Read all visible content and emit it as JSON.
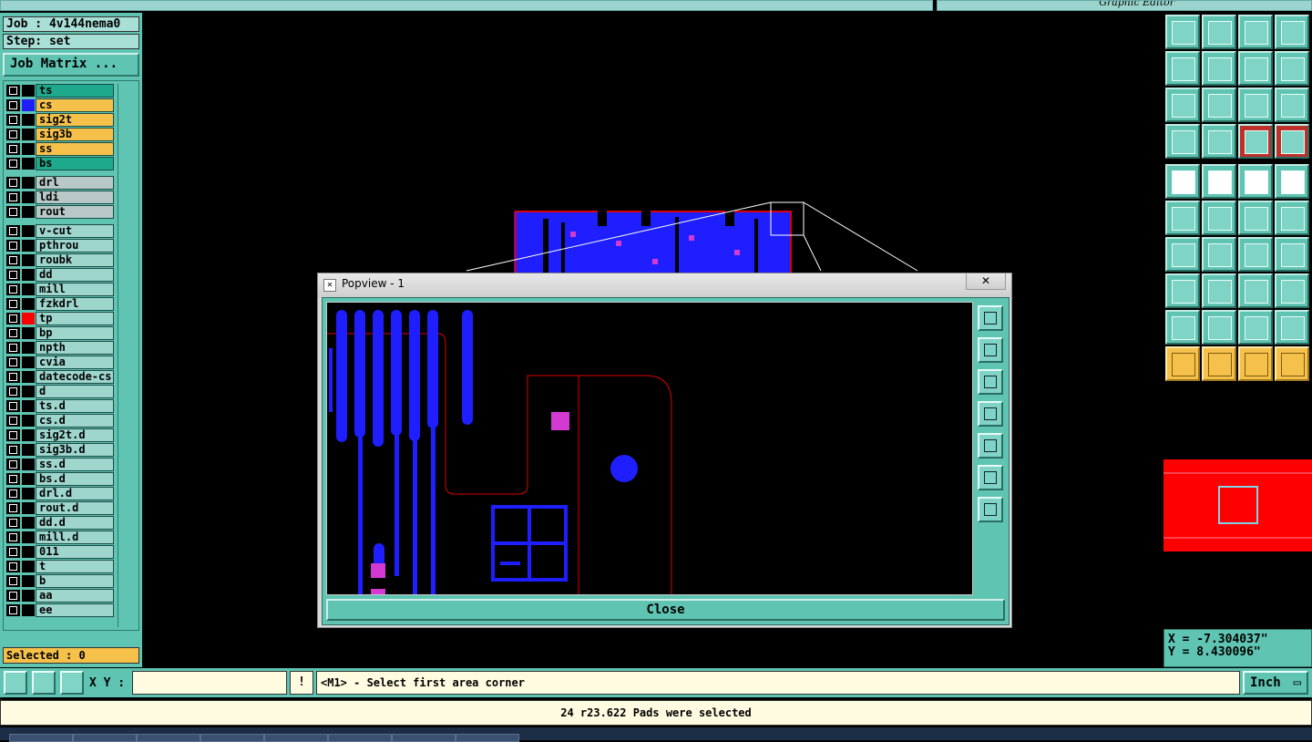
{
  "top_bar": {
    "right_title": "Graphic Editor"
  },
  "left_panel": {
    "job": "Job : 4v144nema0",
    "step": "Step: set",
    "job_matrix_label": "Job Matrix ...",
    "selected": "Selected : 0",
    "layers": [
      {
        "name": "ts",
        "kind": "board",
        "color": "#000000"
      },
      {
        "name": "cs",
        "kind": "sig",
        "color": "#1e1eff"
      },
      {
        "name": "sig2t",
        "kind": "sig",
        "color": "#000000"
      },
      {
        "name": "sig3b",
        "kind": "sig",
        "color": "#000000"
      },
      {
        "name": "ss",
        "kind": "sig",
        "color": "#000000"
      },
      {
        "name": "bs",
        "kind": "board",
        "color": "#000000"
      },
      {
        "name": "drl",
        "kind": "drill",
        "color": "#000000"
      },
      {
        "name": "ldi",
        "kind": "drill",
        "color": "#000000"
      },
      {
        "name": "rout",
        "kind": "drill",
        "color": "#000000"
      },
      {
        "name": "v-cut",
        "kind": "misc",
        "color": "#000000"
      },
      {
        "name": "pthrou",
        "kind": "misc",
        "color": "#000000"
      },
      {
        "name": "roubk",
        "kind": "misc",
        "color": "#000000"
      },
      {
        "name": "dd",
        "kind": "misc",
        "color": "#000000"
      },
      {
        "name": "mill",
        "kind": "misc",
        "color": "#000000"
      },
      {
        "name": "fzkdrl",
        "kind": "misc",
        "color": "#000000"
      },
      {
        "name": "tp",
        "kind": "misc",
        "color": "#ff0000"
      },
      {
        "name": "bp",
        "kind": "misc",
        "color": "#000000"
      },
      {
        "name": "npth",
        "kind": "misc",
        "color": "#000000"
      },
      {
        "name": "cvia",
        "kind": "misc",
        "color": "#000000"
      },
      {
        "name": "datecode-cs",
        "kind": "misc",
        "color": "#000000"
      },
      {
        "name": "d",
        "kind": "misc",
        "color": "#000000"
      },
      {
        "name": "ts.d",
        "kind": "misc",
        "color": "#000000"
      },
      {
        "name": "cs.d",
        "kind": "misc",
        "color": "#000000"
      },
      {
        "name": "sig2t.d",
        "kind": "misc",
        "color": "#000000"
      },
      {
        "name": "sig3b.d",
        "kind": "misc",
        "color": "#000000"
      },
      {
        "name": "ss.d",
        "kind": "misc",
        "color": "#000000"
      },
      {
        "name": "bs.d",
        "kind": "misc",
        "color": "#000000"
      },
      {
        "name": "drl.d",
        "kind": "misc",
        "color": "#000000"
      },
      {
        "name": "rout.d",
        "kind": "misc",
        "color": "#000000"
      },
      {
        "name": "dd.d",
        "kind": "misc",
        "color": "#000000"
      },
      {
        "name": "mill.d",
        "kind": "misc",
        "color": "#000000"
      },
      {
        "name": "011",
        "kind": "misc",
        "color": "#000000"
      },
      {
        "name": "t",
        "kind": "misc",
        "color": "#000000"
      },
      {
        "name": "b",
        "kind": "misc",
        "color": "#000000"
      },
      {
        "name": "aa",
        "kind": "misc",
        "color": "#000000"
      },
      {
        "name": "ee",
        "kind": "misc",
        "color": "#000000"
      }
    ]
  },
  "popview": {
    "title": "Popview - 1",
    "close_x": "✕",
    "close_label": "Close"
  },
  "right_panel": {
    "coord_x": "X = -7.304037\"",
    "coord_y": "Y = 8.430096\"",
    "tools": [
      "layer-up-icon",
      "layer-down-icon",
      "home-icon",
      "window-icon",
      "pan-left-icon",
      "pan-right-icon",
      "undo-zoom-icon",
      "redo-zoom-icon",
      "fit-icon",
      "center-icon",
      "one-to-one-icon",
      "help-icon",
      "settings-icon",
      "snap-icon",
      "net-red-icon",
      "net-red2-icon",
      "add-pad-icon",
      "add-line-icon",
      "measure-icon",
      "pad-dot-icon",
      "connect-icon",
      "delete-icon",
      "move-icon",
      "copy-icon",
      "angle-icon",
      "arc-icon",
      "rotate-icon",
      "mirror-icon",
      "attr-pad-icon",
      "line-icon",
      "dimension-icon",
      "cut-icon",
      "arch-triangle-icon",
      "text-a-icon",
      "text-a-bold-icon",
      "text-a-x-icon",
      "select-icon",
      "select-box-icon",
      "select-lasso-icon",
      "select-net-icon"
    ]
  },
  "bottom": {
    "xy_label": "X Y :",
    "xy_value": "",
    "warn": "!",
    "prompt": "<M1> - Select first area corner",
    "unit": "Inch",
    "status": "24 r23.622 Pads were selected"
  }
}
